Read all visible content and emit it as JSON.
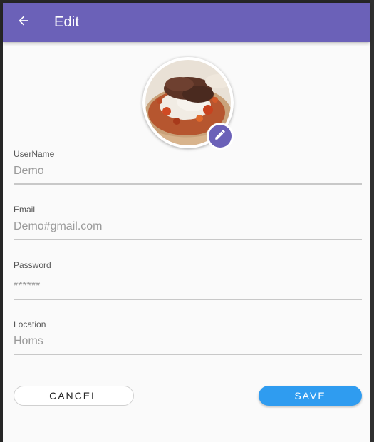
{
  "appbar": {
    "title": "Edit",
    "back_icon": "arrow-left-icon",
    "color": "#6b61b8"
  },
  "profile": {
    "photo_alt": "profile photo",
    "edit_icon": "pencil-icon"
  },
  "form": {
    "username": {
      "label": "UserName",
      "value": "Demo"
    },
    "email": {
      "label": "Email",
      "value": "Demo#gmail.com"
    },
    "password": {
      "label": "Password",
      "value": "******"
    },
    "location": {
      "label": "Location",
      "value": "Homs"
    }
  },
  "actions": {
    "cancel_label": "CANCEL",
    "save_label": "SAVE",
    "save_color": "#2f9cf0"
  }
}
